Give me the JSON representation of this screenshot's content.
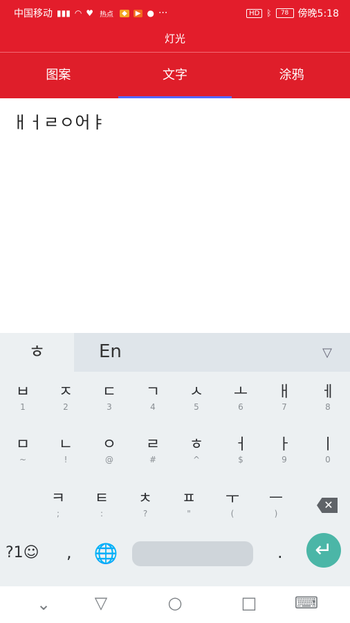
{
  "status_bar": {
    "carrier": "中国移动",
    "signal_prefix": "⁴ᴳ",
    "badge_text": "热点",
    "hd_badge": "HD",
    "battery": "78",
    "time": "傍晚5:18",
    "more": "···"
  },
  "app": {
    "title": "灯光",
    "tabs": [
      {
        "label": "图案"
      },
      {
        "label": "文字"
      },
      {
        "label": "涂鸦"
      }
    ]
  },
  "content": {
    "text": "ㅐㅓㄹㅇ어ㅑ"
  },
  "keyboard": {
    "language_hangul": "ㅎ",
    "language_en": "En",
    "dropdown_icon": "▽",
    "rows": [
      [
        {
          "main": "ㅂ",
          "sub": "1"
        },
        {
          "main": "ㅈ",
          "sub": "2"
        },
        {
          "main": "ㄷ",
          "sub": "3"
        },
        {
          "main": "ㄱ",
          "sub": "4"
        },
        {
          "main": "ㅅ",
          "sub": "5"
        },
        {
          "main": "ㅗ",
          "sub": "6"
        },
        {
          "main": "ㅐ",
          "sub": "7"
        },
        {
          "main": "ㅔ",
          "sub": "8"
        }
      ],
      [
        {
          "main": "ㅁ",
          "sub": "~"
        },
        {
          "main": "ㄴ",
          "sub": "!"
        },
        {
          "main": "ㅇ",
          "sub": "@"
        },
        {
          "main": "ㄹ",
          "sub": "#"
        },
        {
          "main": "ㅎ",
          "sub": "^"
        },
        {
          "main": "ㅓ",
          "sub": "$"
        },
        {
          "main": "ㅏ",
          "sub": "9"
        },
        {
          "main": "ㅣ",
          "sub": "0"
        }
      ],
      [
        {
          "main": "ㅋ",
          "sub": ";"
        },
        {
          "main": "ㅌ",
          "sub": ":"
        },
        {
          "main": "ㅊ",
          "sub": "?"
        },
        {
          "main": "ㅍ",
          "sub": "\""
        },
        {
          "main": "ㅜ",
          "sub": "("
        },
        {
          "main": "ㅡ",
          "sub": ")"
        }
      ]
    ],
    "symbols_label": "?1☺",
    "comma": ",",
    "period": ".",
    "globe": "🌐",
    "enter": "↵",
    "backspace": "✕"
  },
  "nav_bar": {
    "keyboard_icon": "⌨"
  }
}
